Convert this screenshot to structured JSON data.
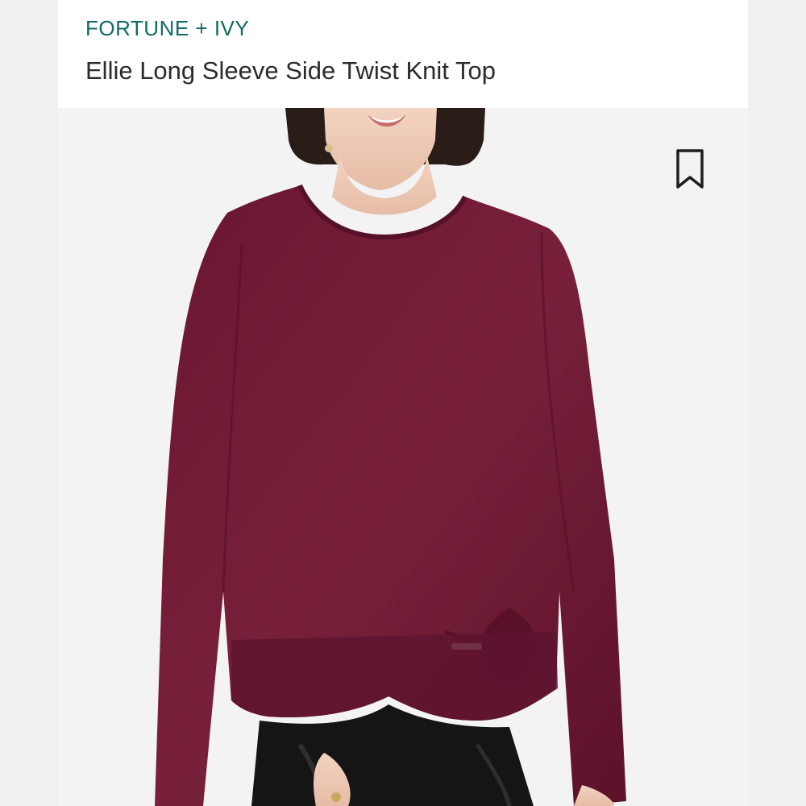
{
  "product": {
    "brand": "FORTUNE + IVY",
    "title": "Ellie Long Sleeve Side Twist Knit Top"
  },
  "image": {
    "alt": "Model wearing a burgundy long sleeve side twist knit top with black pants",
    "garment_color": "#6e1a33"
  },
  "icons": {
    "bookmark": "bookmark-icon"
  },
  "colors": {
    "brand": "#0f6b64",
    "title": "#2b2b2b",
    "background": "#efeff1"
  }
}
